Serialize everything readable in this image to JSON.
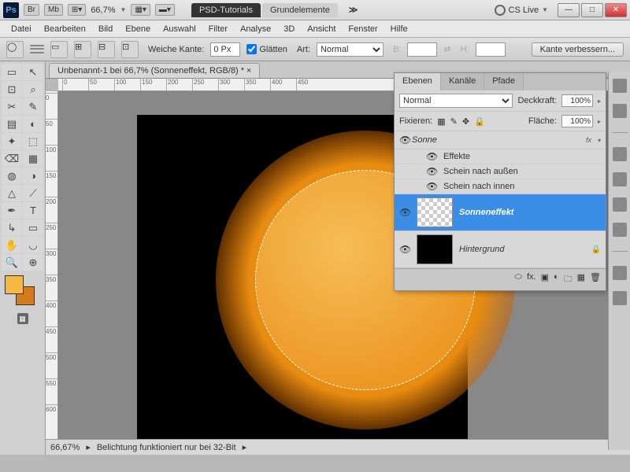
{
  "titlebar": {
    "br": "Br",
    "mb": "Mb",
    "zoom": "66,7%",
    "tab1": "PSD-Tutorials",
    "tab2": "Grundelemente",
    "cslive": "CS Live"
  },
  "menu": [
    "Datei",
    "Bearbeiten",
    "Bild",
    "Ebene",
    "Auswahl",
    "Filter",
    "Analyse",
    "3D",
    "Ansicht",
    "Fenster",
    "Hilfe"
  ],
  "options": {
    "featherLabel": "Weiche Kante:",
    "featherValue": "0 Px",
    "antialias": "Glätten",
    "styleLabel": "Art:",
    "styleValue": "Normal",
    "widthLabel": "B:",
    "heightLabel": "H:",
    "refine": "Kante verbessern..."
  },
  "doc": {
    "tab": "Unbenannt-1 bei 66,7% (Sonneneffekt, RGB/8) *"
  },
  "rulerH": [
    "0",
    "50",
    "100",
    "150",
    "200",
    "250",
    "300",
    "350",
    "400",
    "450"
  ],
  "rulerV": [
    "0",
    "50",
    "100",
    "150",
    "200",
    "250",
    "300",
    "350",
    "400",
    "450",
    "500",
    "550",
    "600"
  ],
  "status": {
    "zoom": "66,67%",
    "msg": "Belichtung funktioniert nur bei 32-Bit"
  },
  "panel": {
    "tabs": [
      "Ebenen",
      "Kanäle",
      "Pfade"
    ],
    "blendMode": "Normal",
    "opacityLabel": "Deckkraft:",
    "opacityValue": "100%",
    "lockLabel": "Fixieren:",
    "fillLabel": "Fläche:",
    "fillValue": "100%",
    "layers": {
      "sun": "Sonne",
      "fxLabel": "Effekte",
      "outerGlow": "Schein nach außen",
      "innerGlow": "Schein nach innen",
      "sonneneffekt": "Sonneneffekt",
      "background": "Hintergrund",
      "fx": "fx"
    }
  },
  "tools": [
    "▭",
    "↖",
    "⊡",
    "⌕",
    "✂",
    "✎",
    "▤",
    "◐",
    "✦",
    "⬚",
    "⌫",
    "▦",
    "◍",
    "◑",
    "△",
    "⬡",
    "◉",
    "⟋",
    "✒",
    "T",
    "↳",
    "▭",
    "✋",
    "◡",
    "⊕",
    "🔍"
  ]
}
